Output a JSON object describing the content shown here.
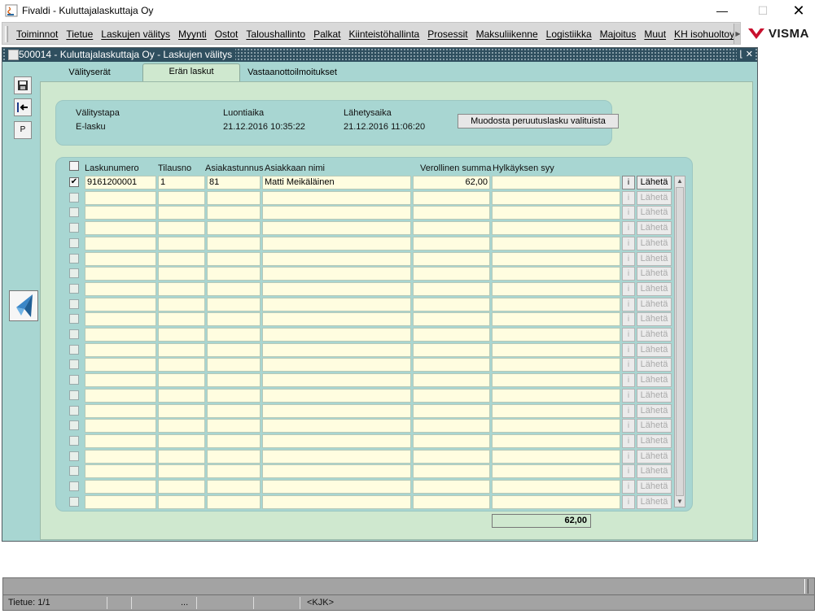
{
  "window": {
    "title": "Fivaldi - Kuluttajalaskuttaja Oy",
    "minimize": "—",
    "maximize": "☐",
    "close": "✕"
  },
  "menu": {
    "items": [
      {
        "mn": "T",
        "rest": "oiminnot"
      },
      {
        "mn": "T",
        "rest": "ietue"
      },
      {
        "mn": "L",
        "rest": "askujen välitys"
      },
      {
        "mn": "M",
        "rest": "yynti"
      },
      {
        "mn": "O",
        "rest": "stot"
      },
      {
        "mn": "T",
        "rest": "aloushallinto"
      },
      {
        "mn": "P",
        "rest": "alkat"
      },
      {
        "mn": "K",
        "rest": "iinteistöhallinta"
      },
      {
        "mn": "P",
        "rest": "rosessit"
      },
      {
        "mn": "M",
        "rest": "aksuliikenne"
      },
      {
        "mn": "L",
        "rest": "ogistiikka"
      },
      {
        "mn": "M",
        "rest": "ajoitus"
      },
      {
        "mn": "M",
        "rest": "uut"
      },
      {
        "mn": "K",
        "rest": "H isohuoltoyhtiö"
      }
    ],
    "scroll_right": "▶",
    "brand": "VISMA",
    "brand_color": "#c8102e"
  },
  "frame": {
    "title": "500014 - Kuluttajalaskuttaja Oy - Laskujen välitys",
    "title_buttons": "⌊ ✕"
  },
  "toolbar": {
    "save_icon": "save-icon",
    "exit_icon": "exit-icon",
    "p_label": "P"
  },
  "tabs": [
    {
      "label": "Välityserät",
      "active": false
    },
    {
      "label": "Erän laskut",
      "active": true
    },
    {
      "label": "Vastaanottoilmoitukset",
      "active": false
    }
  ],
  "info": {
    "valitystapa_label": "Välitystapa",
    "valitystapa_value": "E-lasku",
    "luontiaika_label": "Luontiaika",
    "luontiaika_value": "21.12.2016 10:35:22",
    "lahetysaika_label": "Lähetysaika",
    "lahetysaika_value": "21.12.2016 11:06:20",
    "peruutus_button": "Muodosta peruutuslasku valituista"
  },
  "table": {
    "headers": {
      "laskunumero": "Laskunumero",
      "tilausno": "Tilausno",
      "asiakastunnus": "Asiakastunnus",
      "asiakkaan_nimi": "Asiakkaan nimi",
      "verollinen_summa": "Verollinen summa",
      "hylkayksen_syy": "Hylkäyksen syy"
    },
    "rows": [
      {
        "checked": true,
        "laskunumero": "9161200001",
        "tilausno": "1",
        "asiakastunnus": "81",
        "nimi": "Matti Meikäläinen",
        "summa": "62,00",
        "syy": "",
        "enabled": true
      }
    ],
    "empty_rows": 21,
    "info_button": "i",
    "send_button": "Lähetä",
    "total": "62,00"
  },
  "status": {
    "record": "Tietue: 1/1",
    "dots": "...",
    "mode": "<KJK>"
  }
}
